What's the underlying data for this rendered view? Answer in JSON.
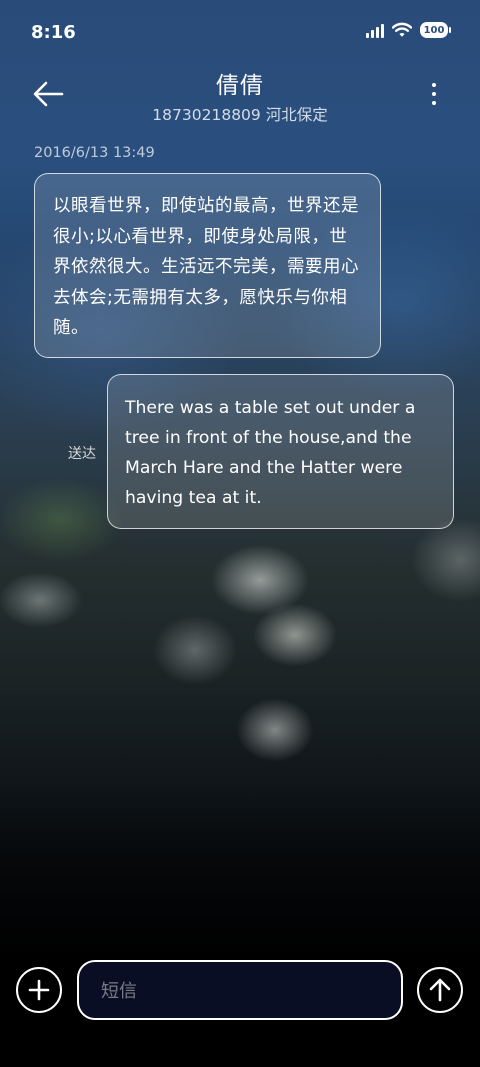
{
  "status_bar": {
    "time": "8:16",
    "battery": "100"
  },
  "header": {
    "contact_name": "倩倩",
    "subtitle": "18730218809 河北保定"
  },
  "conversation": {
    "timestamp": "2016/6/13 13:49",
    "incoming": {
      "text": "以眼看世界，即使站的最高，世界还是很小;以心看世界，即使身处局限，世界依然很大。生活远不完美，需要用心去体会;无需拥有太多，愿快乐与你相随。"
    },
    "outgoing": {
      "text": "There was a table set out under a tree in front of the house,and the March Hare and the Hatter were having tea at it.",
      "status": "送达"
    }
  },
  "composer": {
    "placeholder": "短信"
  },
  "icons": {
    "back": "arrow-left-icon",
    "more": "more-vertical-icon",
    "add": "plus-icon",
    "send": "arrow-up-icon"
  }
}
